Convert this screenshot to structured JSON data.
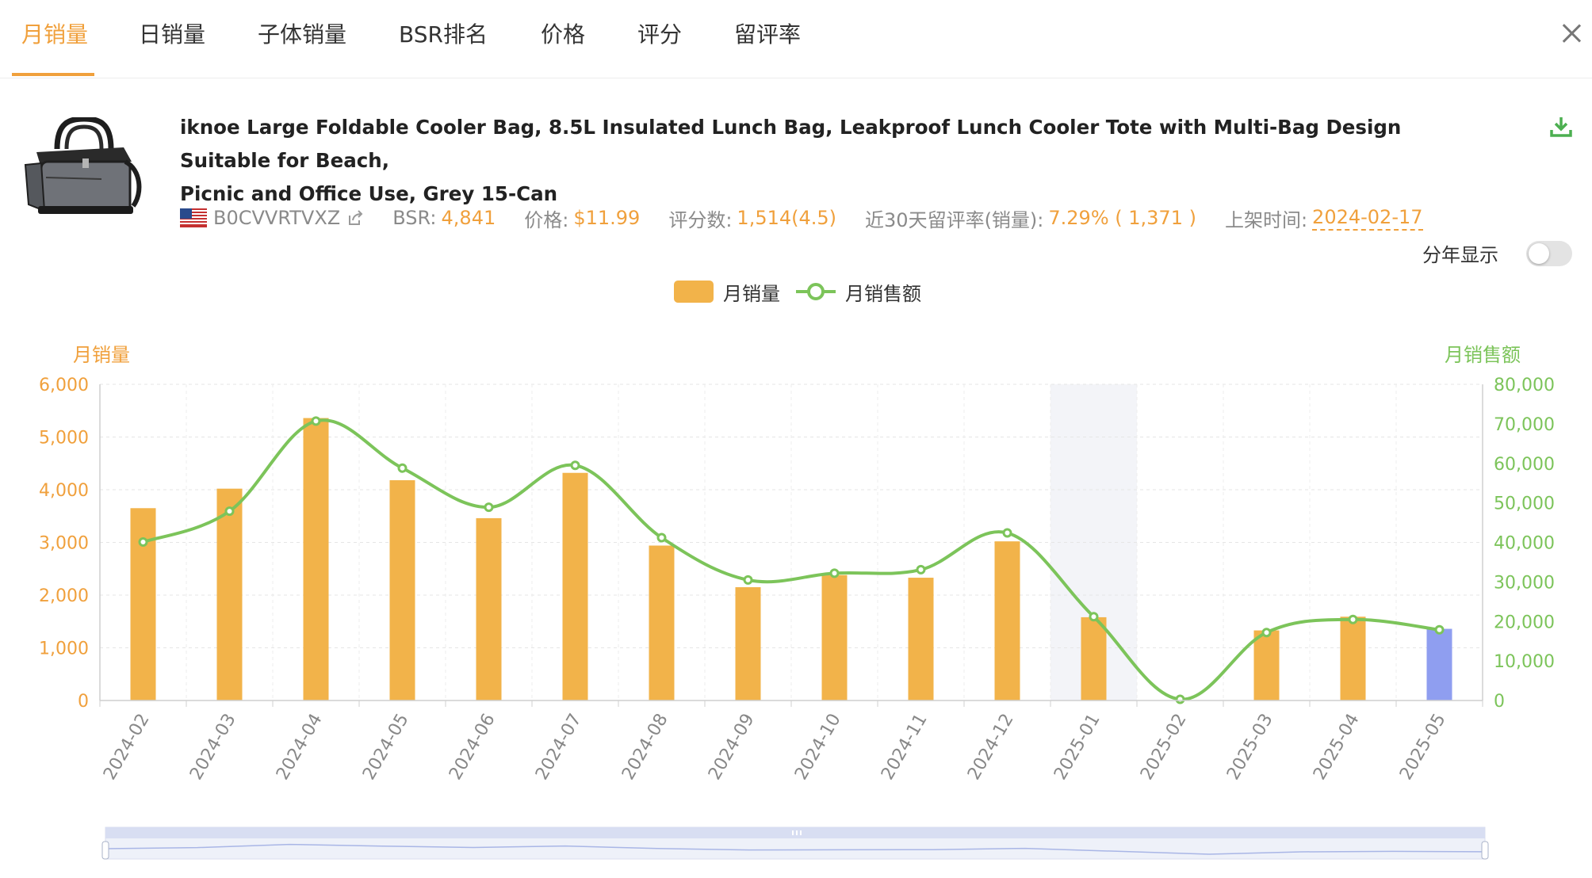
{
  "tabs": [
    {
      "label": "月销量",
      "active": true
    },
    {
      "label": "日销量"
    },
    {
      "label": "子体销量"
    },
    {
      "label": "BSR排名"
    },
    {
      "label": "价格"
    },
    {
      "label": "评分"
    },
    {
      "label": "留评率"
    }
  ],
  "product": {
    "title_line1": "iknoe Large Foldable Cooler Bag, 8.5L Insulated Lunch Bag, Leakproof Lunch Cooler Tote with Multi-Bag Design Suitable for Beach,",
    "title_line2": "Picnic and Office Use, Grey 15-Can",
    "asin": "B0CVVRTVXZ",
    "bsr_label": "BSR:",
    "bsr_value": "4,841",
    "price_label": "价格:",
    "price_value": "$11.99",
    "reviews_label": "评分数:",
    "reviews_value": "1,514(4.5)",
    "review_rate_label": "近30天留评率(销量):",
    "review_rate_value": "7.29% ( 1,371 )",
    "launch_label": "上架时间:",
    "launch_value": "2024-02-17"
  },
  "controls": {
    "year_toggle_label": "分年显示",
    "year_toggle_on": false
  },
  "colors": {
    "accent": "#f0a03c",
    "bar": "#f2b34a",
    "bar_highlight": "#8f9ef0",
    "line": "#7cc45a",
    "shade": "#f3f4f8"
  },
  "chart_data": {
    "type": "bar",
    "categories": [
      "2024-02",
      "2024-03",
      "2024-04",
      "2024-05",
      "2024-06",
      "2024-07",
      "2024-08",
      "2024-09",
      "2024-10",
      "2024-11",
      "2024-12",
      "2025-01",
      "2025-02",
      "2025-03",
      "2025-04",
      "2025-05"
    ],
    "series": [
      {
        "name": "月销量",
        "type": "bar",
        "axis": "left",
        "values": [
          3650,
          4020,
          5360,
          4180,
          3460,
          4320,
          2940,
          2150,
          2380,
          2330,
          3020,
          1580,
          0,
          1330,
          1590,
          1360
        ]
      },
      {
        "name": "月销售额",
        "type": "line",
        "axis": "right",
        "values": [
          40100,
          47900,
          70700,
          58800,
          48900,
          59500,
          41200,
          30500,
          32200,
          33100,
          42400,
          21200,
          300,
          17200,
          20500,
          17900
        ]
      }
    ],
    "ylabel_left": "月销量",
    "ylabel_right": "月销售额",
    "ylim_left": [
      0,
      6000
    ],
    "ylim_right": [
      0,
      80000
    ],
    "yticks_left": [
      "0",
      "1,000",
      "2,000",
      "3,000",
      "4,000",
      "5,000",
      "6,000"
    ],
    "yticks_right": [
      "0",
      "10,000",
      "20,000",
      "30,000",
      "40,000",
      "50,000",
      "60,000",
      "70,000",
      "80,000"
    ],
    "highlight_bar_category": "2025-05",
    "shaded_category": "2025-01",
    "legend_position": "top-center",
    "grid": true
  }
}
